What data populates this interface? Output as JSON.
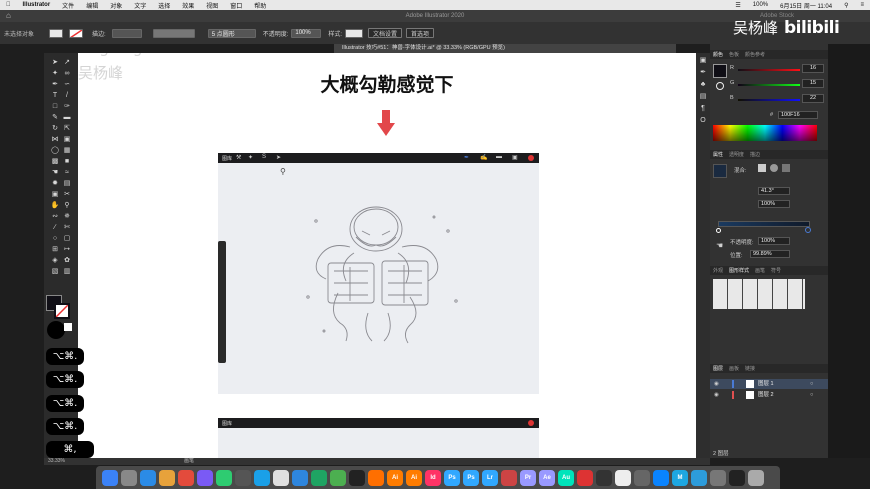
{
  "menubar": {
    "app": "Illustrator",
    "items": [
      "文件",
      "编辑",
      "对象",
      "文字",
      "选择",
      "效果",
      "视图",
      "窗口",
      "帮助"
    ],
    "battery": "100%",
    "datetime": "6月15日 周一 11:04"
  },
  "window": {
    "title": "Adobe Illustrator 2020",
    "stock_search": "Adobe Stock"
  },
  "control_bar": {
    "selection": "未选择对象",
    "stroke_label": "描边:",
    "brush": "5 点圆形",
    "opacity_label": "不透明度:",
    "opacity": "100%",
    "style_label": "样式:",
    "doc_setup": "文档设置",
    "prefs": "首选项"
  },
  "document_tab": {
    "label": "Illustrator 技巧#51：神兽-字体设计.ai* @ 33.33% (RGB/GPU 预览)"
  },
  "canvas": {
    "headline": "大概勾勒感觉下",
    "sketch_label": "神兽"
  },
  "color_panel": {
    "tabs": [
      "颜色",
      "色板",
      "颜色参考"
    ],
    "r_label": "R",
    "g_label": "G",
    "b_label": "B",
    "r": "16",
    "g": "15",
    "b": "22",
    "hex_prefix": "#",
    "hex": "100F16",
    "fill": "#100f16"
  },
  "appearance_panel": {
    "tabs": [
      "属性",
      "透明度",
      "描边"
    ],
    "blend_label": "混合:",
    "angle": "41.3°",
    "scale": "100%",
    "opacity_label": "不透明度:",
    "opacity": "100%",
    "location_label": "位置:",
    "location": "99.89%"
  },
  "graphic_styles_panel": {
    "tabs": [
      "外观",
      "图形样式",
      "画笔",
      "符号"
    ]
  },
  "layers_panel": {
    "tabs": [
      "图层",
      "画板",
      "链接"
    ],
    "layers": [
      {
        "name": "图层 1",
        "color": "#4a7bd5"
      },
      {
        "name": "图层 2",
        "color": "#e05050"
      }
    ],
    "footer": "2 图层"
  },
  "status": {
    "zoom": "33.33%",
    "tool": "画笔"
  },
  "keycaps": [
    "⌥⌘.",
    "⌥⌘.",
    "⌥⌘.",
    "⌥⌘.",
    "⌘,"
  ],
  "watermark": {
    "latin": "wuyangfeng",
    "cn": "吴杨峰"
  },
  "logo": {
    "name": "吴杨峰",
    "brand": "bilibili"
  },
  "dock": {
    "apps": [
      {
        "label": "",
        "color": "#3b82f6"
      },
      {
        "label": "",
        "color": "#888"
      },
      {
        "label": "",
        "color": "#2b8be6"
      },
      {
        "label": "",
        "color": "#e7a23b"
      },
      {
        "label": "",
        "color": "#e34b3c"
      },
      {
        "label": "",
        "color": "#7a5af5"
      },
      {
        "label": "",
        "color": "#2ecc71"
      },
      {
        "label": "",
        "color": "#555"
      },
      {
        "label": "",
        "color": "#1aa0e8"
      },
      {
        "label": "",
        "color": "#e0e0e0"
      },
      {
        "label": "",
        "color": "#2e86de"
      },
      {
        "label": "",
        "color": "#1fa463"
      },
      {
        "label": "",
        "color": "#4caf50"
      },
      {
        "label": "",
        "color": "#222"
      },
      {
        "label": "",
        "color": "#ff6f00"
      },
      {
        "label": "Ai",
        "color": "#ff7c00"
      },
      {
        "label": "Ai",
        "color": "#ff7c00"
      },
      {
        "label": "Id",
        "color": "#ff3366"
      },
      {
        "label": "Ps",
        "color": "#31a8ff"
      },
      {
        "label": "Ps",
        "color": "#31a8ff"
      },
      {
        "label": "Lr",
        "color": "#31a8ff"
      },
      {
        "label": "",
        "color": "#c44"
      },
      {
        "label": "Pr",
        "color": "#9999ff"
      },
      {
        "label": "Ae",
        "color": "#9999ff"
      },
      {
        "label": "Au",
        "color": "#00e4bb"
      },
      {
        "label": "",
        "color": "#d33"
      },
      {
        "label": "",
        "color": "#333"
      },
      {
        "label": "",
        "color": "#eee"
      },
      {
        "label": "",
        "color": "#666"
      },
      {
        "label": "",
        "color": "#0a84ff"
      },
      {
        "label": "M",
        "color": "#1ea7e1"
      },
      {
        "label": "",
        "color": "#2d9cdb"
      },
      {
        "label": "",
        "color": "#777"
      },
      {
        "label": "",
        "color": "#222"
      },
      {
        "label": "",
        "color": "#aaa"
      }
    ]
  }
}
